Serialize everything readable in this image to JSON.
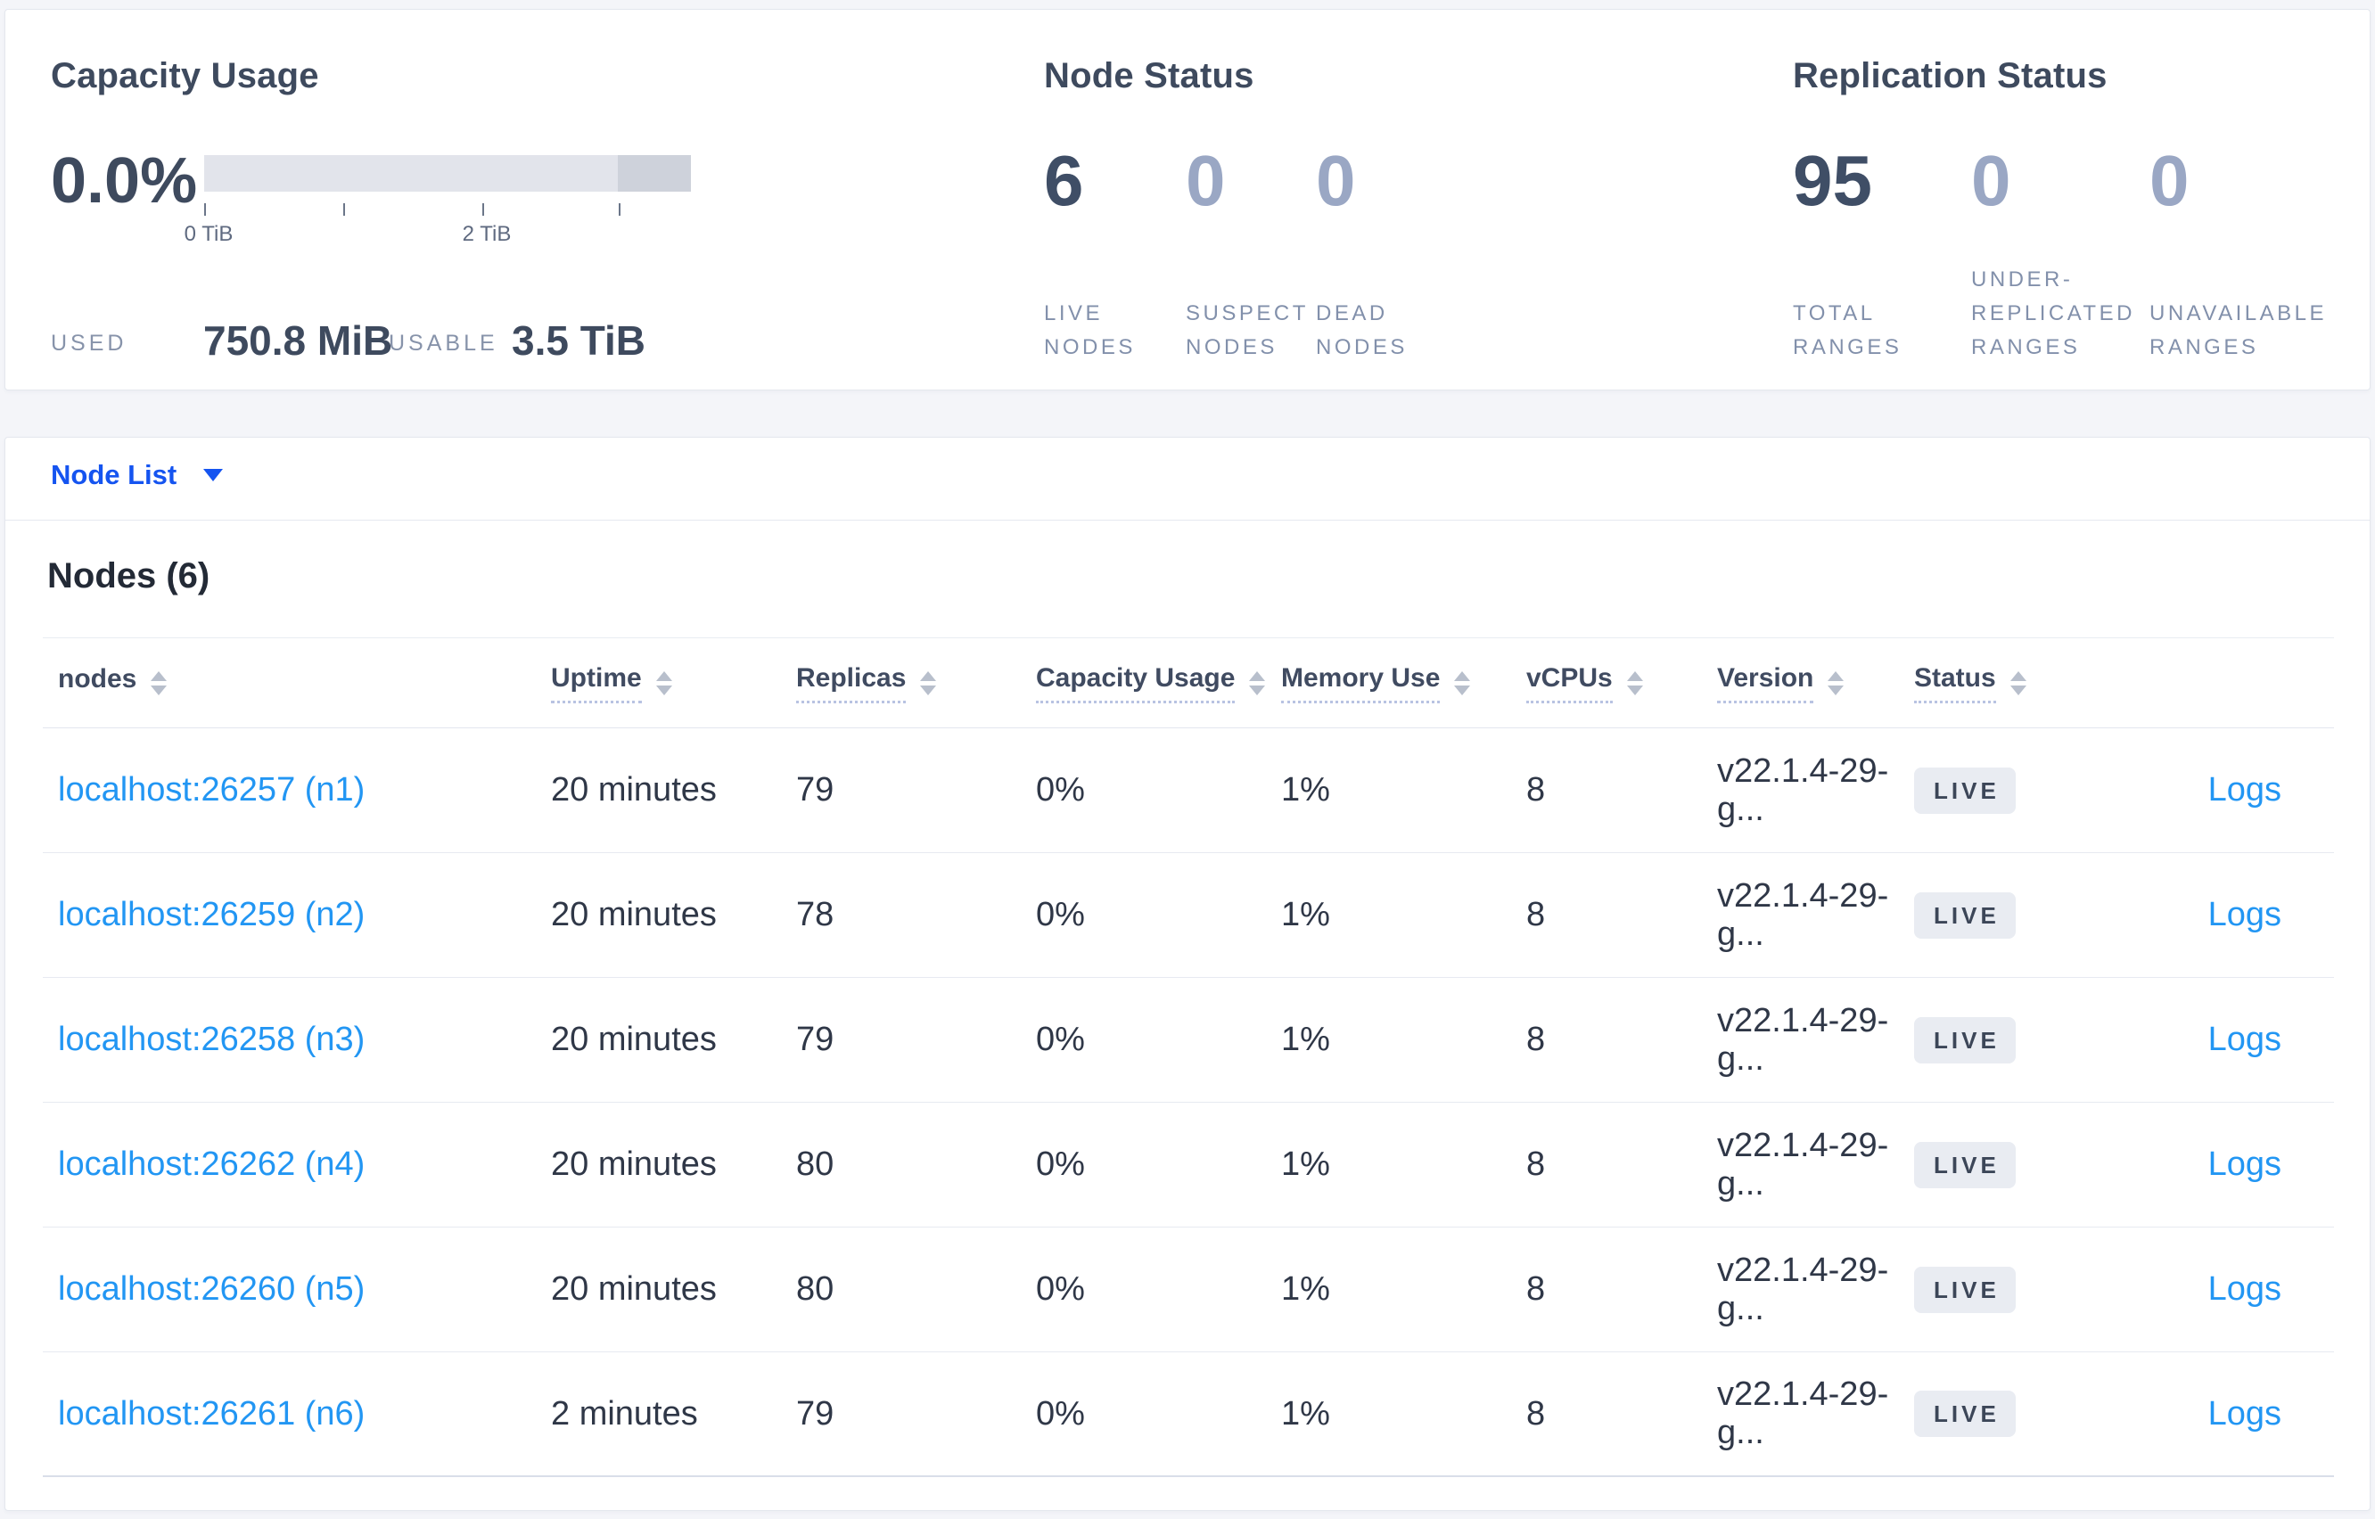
{
  "summary": {
    "capacity": {
      "title": "Capacity Usage",
      "percent": "0.0%",
      "used_label": "USED",
      "used_value": "750.8 MiB",
      "usable_label": "USABLE",
      "usable_value": "3.5 TiB",
      "tick_labels": [
        "0 TiB",
        "2 TiB"
      ],
      "bar": {
        "total_tib": 3.5,
        "tick_positions_tib": [
          0,
          1,
          2,
          3
        ],
        "dark_segment_start_tib": 3.0
      }
    },
    "node_status": {
      "title": "Node Status",
      "stats": [
        {
          "value": "6",
          "label_lines": [
            "LIVE",
            "NODES"
          ],
          "emphasis": true
        },
        {
          "value": "0",
          "label_lines": [
            "SUSPECT",
            "NODES"
          ],
          "emphasis": false
        },
        {
          "value": "0",
          "label_lines": [
            "DEAD",
            "NODES"
          ],
          "emphasis": false
        }
      ]
    },
    "replication_status": {
      "title": "Replication Status",
      "stats": [
        {
          "value": "95",
          "label_lines": [
            "TOTAL",
            "RANGES"
          ],
          "emphasis": true
        },
        {
          "value": "0",
          "label_lines": [
            "UNDER-",
            "REPLICATED",
            "RANGES"
          ],
          "emphasis": false
        },
        {
          "value": "0",
          "label_lines": [
            "UNAVAILABLE",
            "RANGES"
          ],
          "emphasis": false
        }
      ]
    }
  },
  "node_list": {
    "dropdown_label": "Node List",
    "section_title": "Nodes (6)",
    "columns": [
      {
        "label": "nodes",
        "sortable_underline": false
      },
      {
        "label": "Uptime",
        "sortable_underline": true
      },
      {
        "label": "Replicas",
        "sortable_underline": true
      },
      {
        "label": "Capacity Usage",
        "sortable_underline": true
      },
      {
        "label": "Memory Use",
        "sortable_underline": true
      },
      {
        "label": "vCPUs",
        "sortable_underline": true
      },
      {
        "label": "Version",
        "sortable_underline": true
      },
      {
        "label": "Status",
        "sortable_underline": true
      }
    ],
    "logs_label": "Logs",
    "rows": [
      {
        "node": "localhost:26257 (n1)",
        "uptime": "20 minutes",
        "replicas": "79",
        "capacity": "0%",
        "memory": "1%",
        "vcpus": "8",
        "version": "v22.1.4-29-g...",
        "status": "LIVE"
      },
      {
        "node": "localhost:26259 (n2)",
        "uptime": "20 minutes",
        "replicas": "78",
        "capacity": "0%",
        "memory": "1%",
        "vcpus": "8",
        "version": "v22.1.4-29-g...",
        "status": "LIVE"
      },
      {
        "node": "localhost:26258 (n3)",
        "uptime": "20 minutes",
        "replicas": "79",
        "capacity": "0%",
        "memory": "1%",
        "vcpus": "8",
        "version": "v22.1.4-29-g...",
        "status": "LIVE"
      },
      {
        "node": "localhost:26262 (n4)",
        "uptime": "20 minutes",
        "replicas": "80",
        "capacity": "0%",
        "memory": "1%",
        "vcpus": "8",
        "version": "v22.1.4-29-g...",
        "status": "LIVE"
      },
      {
        "node": "localhost:26260 (n5)",
        "uptime": "20 minutes",
        "replicas": "80",
        "capacity": "0%",
        "memory": "1%",
        "vcpus": "8",
        "version": "v22.1.4-29-g...",
        "status": "LIVE"
      },
      {
        "node": "localhost:26261 (n6)",
        "uptime": "2 minutes",
        "replicas": "79",
        "capacity": "0%",
        "memory": "1%",
        "vcpus": "8",
        "version": "v22.1.4-29-g...",
        "status": "LIVE"
      }
    ]
  },
  "colors": {
    "node_list_blue": "#1554f0",
    "link_blue": "#2296f3",
    "badge_bg": "#e9ecf2",
    "stat_dark": "#3f4e66",
    "stat_muted": "#9aa7c4",
    "page_bg": "#f4f5f9"
  }
}
